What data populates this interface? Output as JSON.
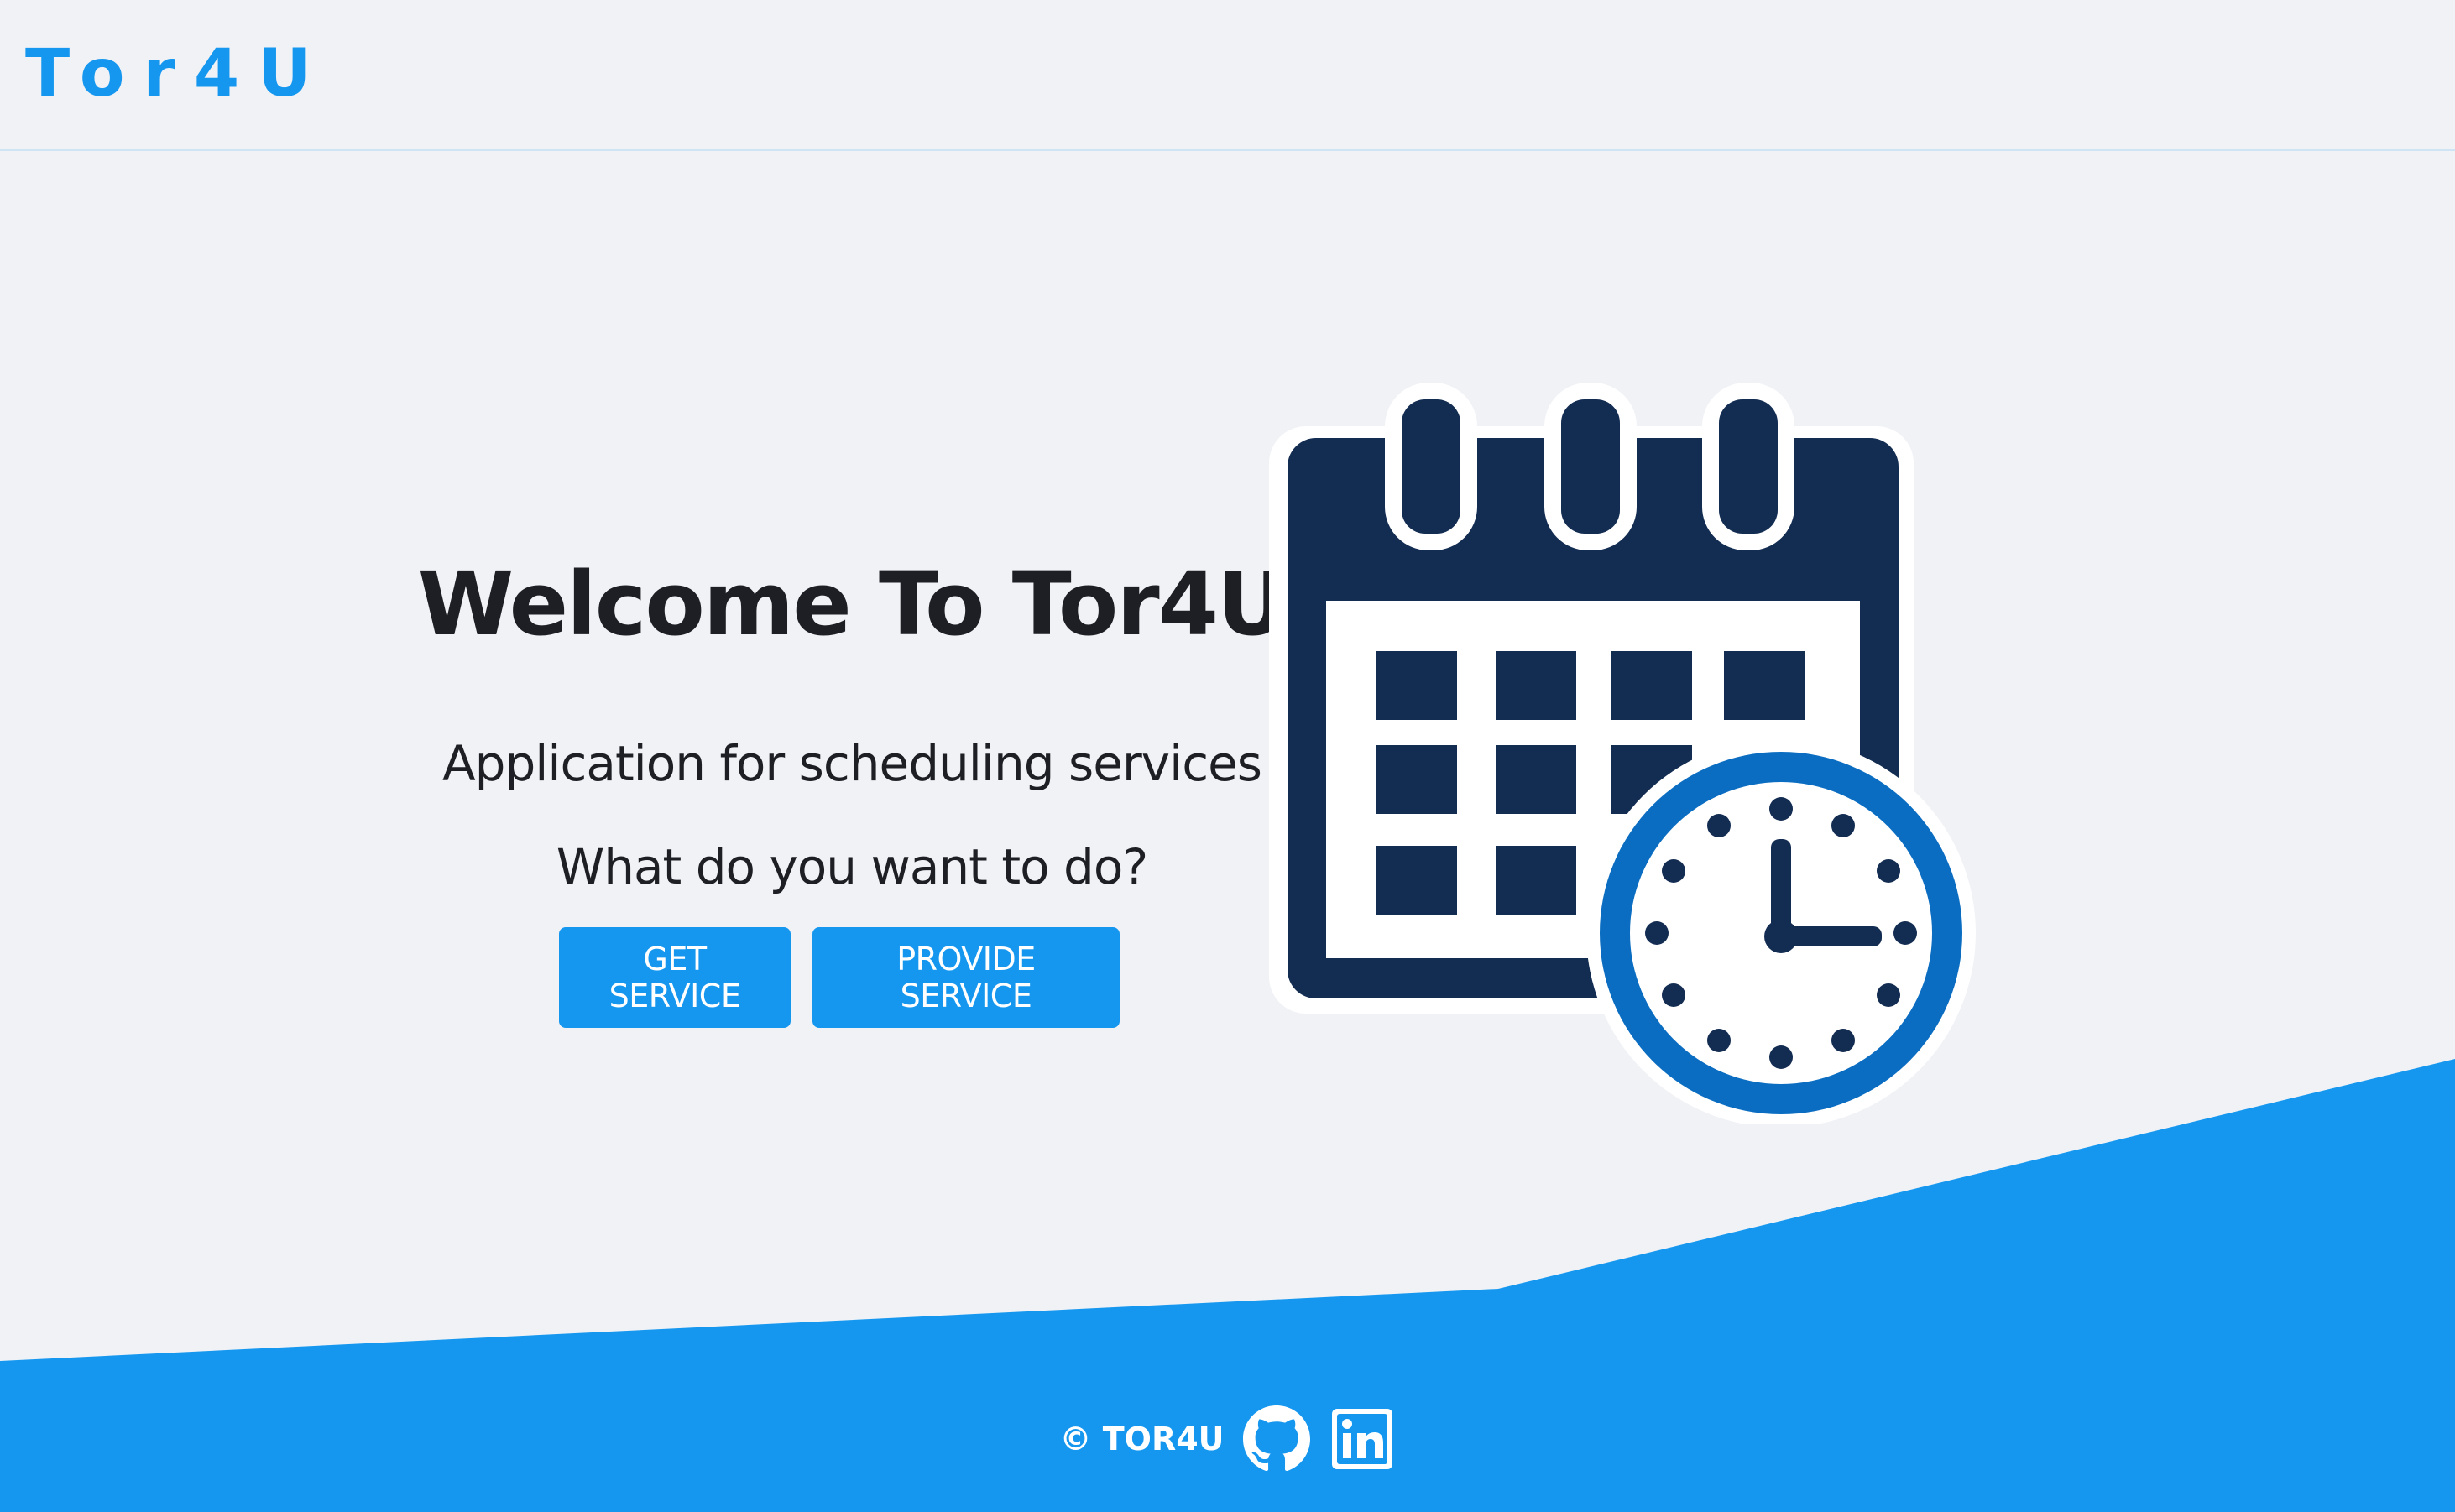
{
  "navbar": {
    "brand": "Tor4U"
  },
  "hero": {
    "title": "Welcome To Tor4U",
    "subtitle": "Application for scheduling services",
    "question": "What do you want to do?",
    "buttons": {
      "get_service": "GET SERVICE",
      "provide_service": "PROVIDE SERVICE"
    },
    "illustration_icon": "calendar-clock-icon"
  },
  "footer": {
    "copyright": "© TOR4U",
    "icons": [
      "github-icon",
      "linkedin-icon"
    ]
  },
  "colors": {
    "accent": "#1597ef",
    "background": "#f0f2f6",
    "illustration_navy": "#132c52",
    "clock_ring": "#0b6dc1",
    "text": "#1d1f24"
  }
}
